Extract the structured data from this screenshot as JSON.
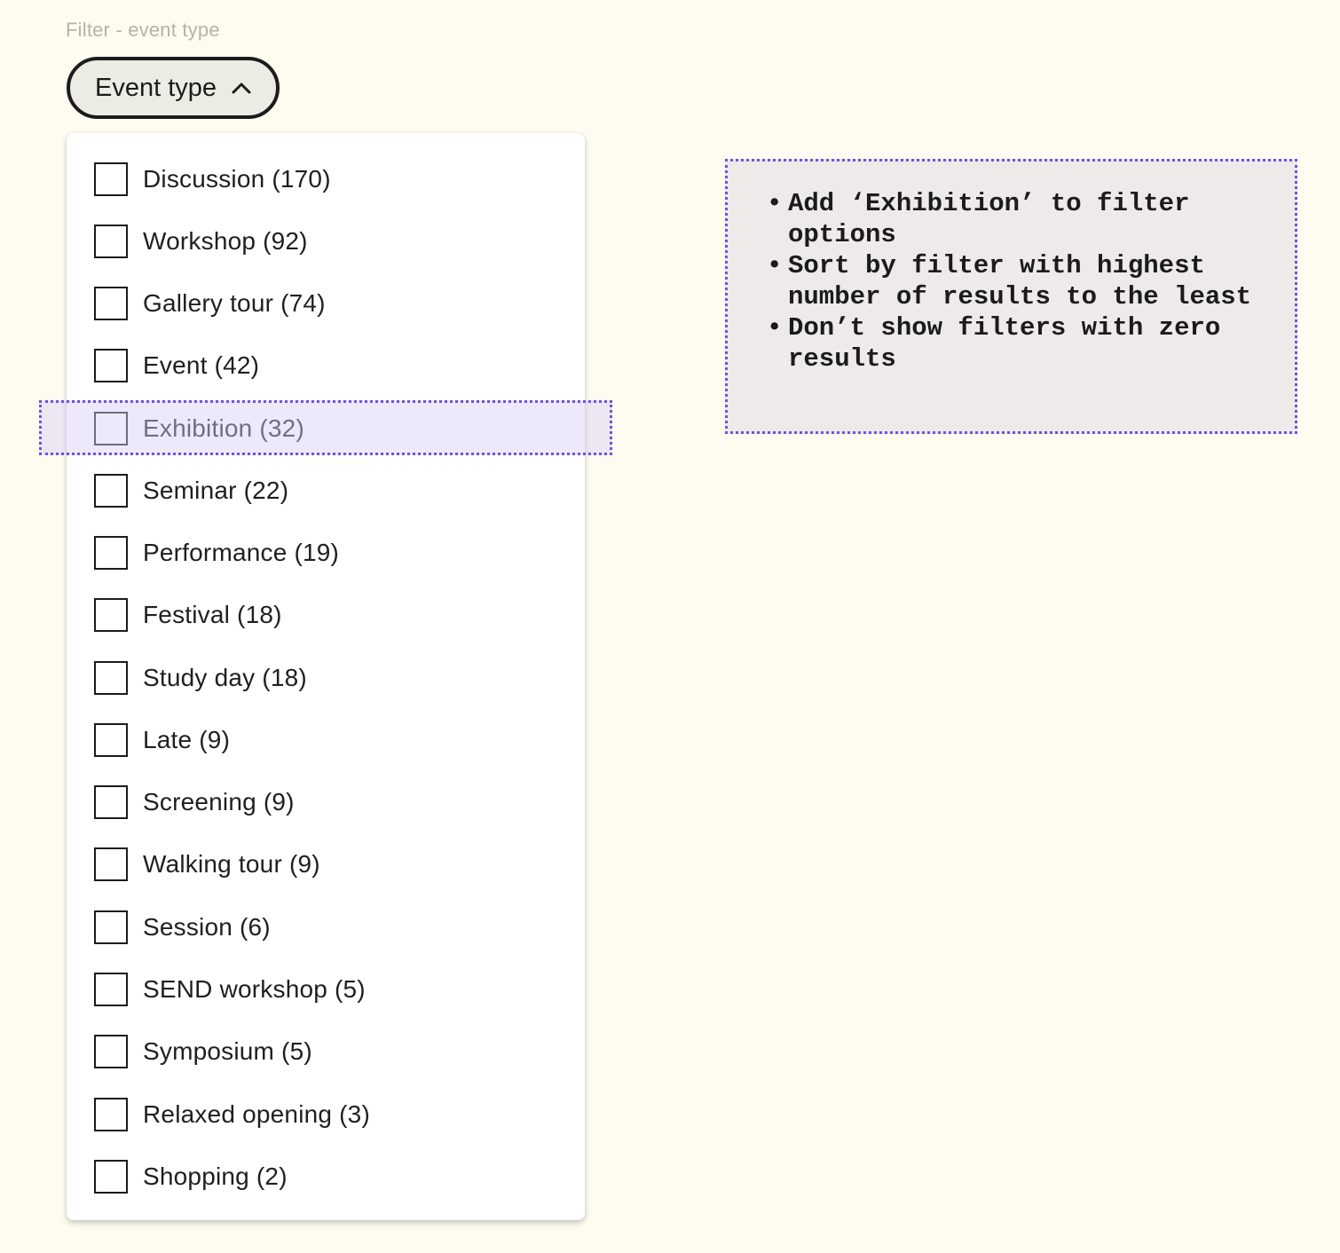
{
  "frame": {
    "label": "Filter - event type"
  },
  "filter_button": {
    "label": "Event type",
    "icon": "chevron-up-icon",
    "expanded": true
  },
  "options": [
    {
      "label": "Discussion (170)",
      "checked": false
    },
    {
      "label": "Workshop (92)",
      "checked": false
    },
    {
      "label": "Gallery tour (74)",
      "checked": false
    },
    {
      "label": "Event (42)",
      "checked": false
    },
    {
      "label": "Exhibition (32)",
      "checked": false,
      "highlighted": true
    },
    {
      "label": "Seminar (22)",
      "checked": false
    },
    {
      "label": "Performance (19)",
      "checked": false
    },
    {
      "label": "Festival (18)",
      "checked": false
    },
    {
      "label": "Study day (18)",
      "checked": false
    },
    {
      "label": "Late (9)",
      "checked": false
    },
    {
      "label": "Screening (9)",
      "checked": false
    },
    {
      "label": "Walking tour (9)",
      "checked": false
    },
    {
      "label": "Session (6)",
      "checked": false
    },
    {
      "label": "SEND workshop (5)",
      "checked": false
    },
    {
      "label": "Symposium (5)",
      "checked": false
    },
    {
      "label": "Relaxed opening (3)",
      "checked": false
    },
    {
      "label": "Shopping (2)",
      "checked": false
    }
  ],
  "annotation": {
    "notes": [
      "Add ‘Exhibition’ to filter options",
      "Sort by filter with highest number of results to the least",
      "Don’t show filters with zero results"
    ]
  },
  "colors": {
    "background": "#fefcf0",
    "annotation_border": "#6f52e0",
    "highlight_fill": "#e6e1f7",
    "note_fill": "#eeeaea",
    "text": "#1e1e1e",
    "frame_label": "#b5b2a8"
  }
}
